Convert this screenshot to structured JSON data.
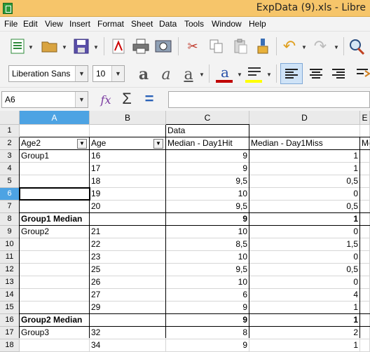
{
  "window": {
    "title": "ExpData (9).xls - Libre"
  },
  "menu": [
    "File",
    "Edit",
    "View",
    "Insert",
    "Format",
    "Sheet",
    "Data",
    "Tools",
    "Window",
    "Help"
  ],
  "toolbar": {
    "font_name": "Liberation Sans",
    "font_size": "10",
    "icons": [
      "new-icon",
      "open-icon",
      "save-icon",
      "export-pdf-icon",
      "print-icon",
      "print-preview-icon",
      "cut-icon",
      "copy-icon",
      "paste-icon",
      "clone-formatting-icon",
      "undo-icon",
      "redo-icon",
      "spelling-icon",
      "bold-icon",
      "italic-icon",
      "underline-icon",
      "font-color-icon",
      "highlight-icon",
      "align-left-icon",
      "align-center-icon",
      "align-right-icon"
    ],
    "colors": {
      "font_color": "#c00000",
      "highlight": "#ffff00",
      "accent": "#4da3e3"
    }
  },
  "formula": {
    "name_box": "A6",
    "content": ""
  },
  "columns": [
    "A",
    "B",
    "C",
    "D",
    "E"
  ],
  "selected_column": "A",
  "selected_row": "6",
  "rows": [
    {
      "n": "1",
      "a": "",
      "b": "",
      "c": "Data",
      "d": "",
      "e": ""
    },
    {
      "n": "2",
      "a": "Age2",
      "b": "Age",
      "c": "Median - Day1Hit",
      "d": "Median - Day1Miss",
      "e": "Me"
    },
    {
      "n": "3",
      "a": "Group1",
      "b": "16",
      "c": "9",
      "d": "1",
      "e": ""
    },
    {
      "n": "4",
      "a": "",
      "b": "17",
      "c": "9",
      "d": "1",
      "e": ""
    },
    {
      "n": "5",
      "a": "",
      "b": "18",
      "c": "9,5",
      "d": "0,5",
      "e": ""
    },
    {
      "n": "6",
      "a": "",
      "b": "19",
      "c": "10",
      "d": "0",
      "e": ""
    },
    {
      "n": "7",
      "a": "",
      "b": "20",
      "c": "9,5",
      "d": "0,5",
      "e": ""
    },
    {
      "n": "8",
      "a": "Group1 Median",
      "b": "",
      "c": "9",
      "d": "1",
      "e": ""
    },
    {
      "n": "9",
      "a": "Group2",
      "b": "21",
      "c": "10",
      "d": "0",
      "e": ""
    },
    {
      "n": "10",
      "a": "",
      "b": "22",
      "c": "8,5",
      "d": "1,5",
      "e": ""
    },
    {
      "n": "11",
      "a": "",
      "b": "23",
      "c": "10",
      "d": "0",
      "e": ""
    },
    {
      "n": "12",
      "a": "",
      "b": "25",
      "c": "9,5",
      "d": "0,5",
      "e": ""
    },
    {
      "n": "13",
      "a": "",
      "b": "26",
      "c": "10",
      "d": "0",
      "e": ""
    },
    {
      "n": "14",
      "a": "",
      "b": "27",
      "c": "6",
      "d": "4",
      "e": ""
    },
    {
      "n": "15",
      "a": "",
      "b": "29",
      "c": "9",
      "d": "1",
      "e": ""
    },
    {
      "n": "16",
      "a": "Group2 Median",
      "b": "",
      "c": "9",
      "d": "1",
      "e": ""
    },
    {
      "n": "17",
      "a": "Group3",
      "b": "32",
      "c": "8",
      "d": "2",
      "e": ""
    },
    {
      "n": "18",
      "a": "",
      "b": "34",
      "c": "9",
      "d": "1",
      "e": ""
    }
  ]
}
